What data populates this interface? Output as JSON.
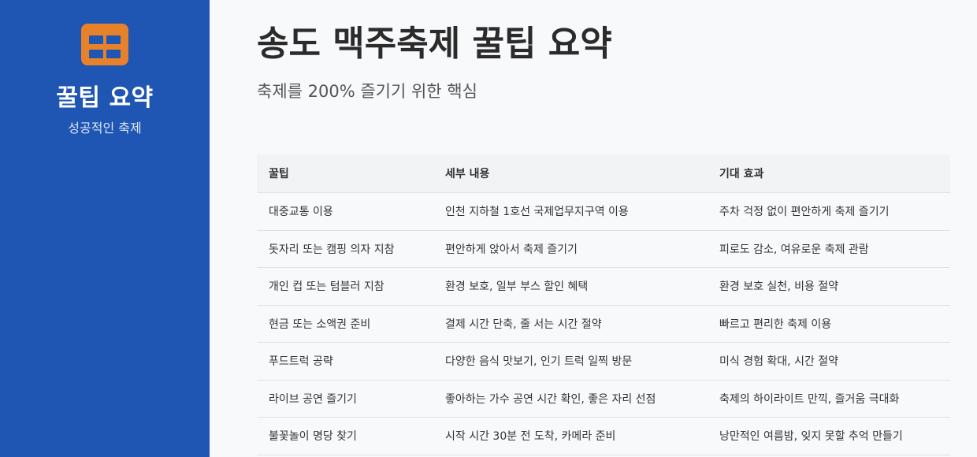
{
  "sidebar": {
    "logo_icon": "table-grid-icon",
    "title": "꿀팁 요약",
    "subtitle": "성공적인 축제",
    "colors": {
      "background": "#1f55b3",
      "logo": "#e8822a"
    }
  },
  "main": {
    "title": "송도 맥주축제 꿀팁 요약",
    "subtitle": "축제를 200% 즐기기 위한 핵심"
  },
  "table": {
    "headers": [
      "꿀팁",
      "세부 내용",
      "기대 효과"
    ],
    "rows": [
      [
        "대중교통 이용",
        "인천 지하철 1호선 국제업무지구역 이용",
        "주차 걱정 없이 편안하게 축제 즐기기"
      ],
      [
        "돗자리 또는 캠핑 의자 지참",
        "편안하게 앉아서 축제 즐기기",
        "피로도 감소, 여유로운 축제 관람"
      ],
      [
        "개인 컵 또는 텀블러 지참",
        "환경 보호, 일부 부스 할인 혜택",
        "환경 보호 실천, 비용 절약"
      ],
      [
        "현금 또는 소액권 준비",
        "결제 시간 단축, 줄 서는 시간 절약",
        "빠르고 편리한 축제 이용"
      ],
      [
        "푸드트럭 공략",
        "다양한 음식 맛보기, 인기 트럭 일찍 방문",
        "미식 경험 확대, 시간 절약"
      ],
      [
        "라이브 공연 즐기기",
        "좋아하는 가수 공연 시간 확인, 좋은 자리 선점",
        "축제의 하이라이트 만끽, 즐거움 극대화"
      ],
      [
        "불꽃놀이 명당 찾기",
        "시작 시간 30분 전 도착, 카메라 준비",
        "낭만적인 여름밤, 잊지 못할 추억 만들기"
      ]
    ]
  }
}
